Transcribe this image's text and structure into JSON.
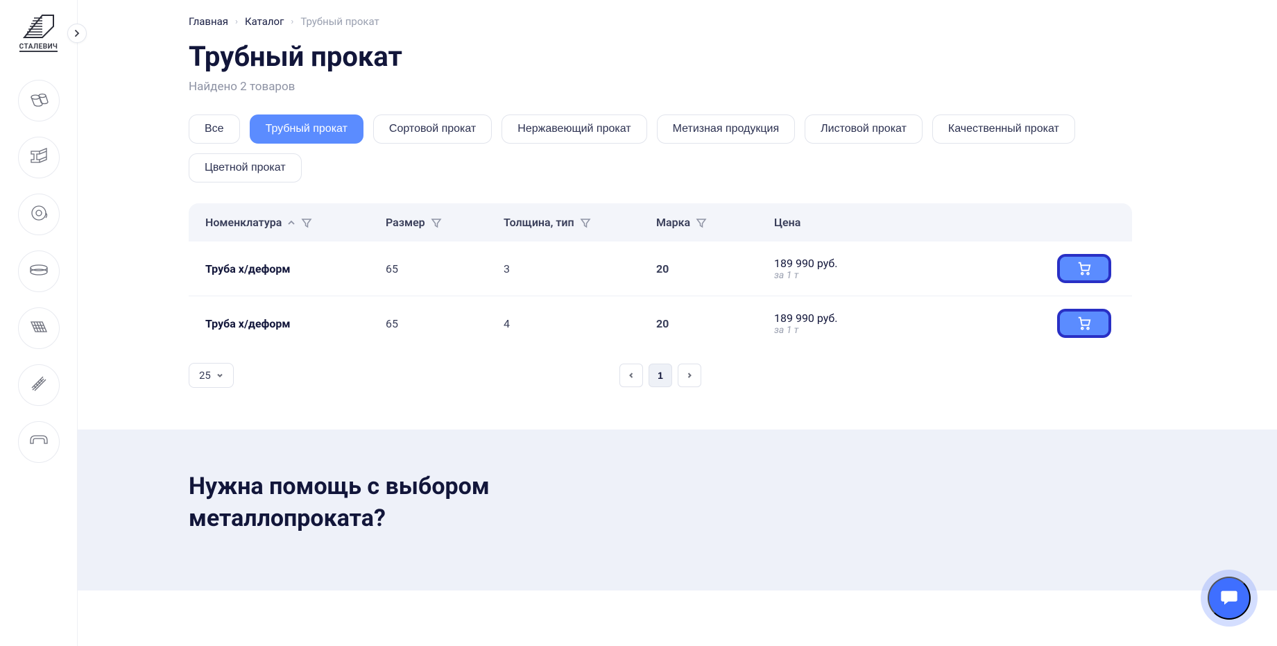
{
  "logo_text": "СТАЛЕВИЧ",
  "breadcrumb": {
    "home": "Главная",
    "catalog": "Каталог",
    "current": "Трубный прокат"
  },
  "page_title": "Трубный прокат",
  "found_text": "Найдено 2 товаров",
  "filters": {
    "items": [
      {
        "label": "Все",
        "active": false
      },
      {
        "label": "Трубный прокат",
        "active": true
      },
      {
        "label": "Сортовой прокат",
        "active": false
      },
      {
        "label": "Нержавеющий прокат",
        "active": false
      },
      {
        "label": "Метизная продукция",
        "active": false
      },
      {
        "label": "Листовой прокат",
        "active": false
      },
      {
        "label": "Качественный прокат",
        "active": false
      },
      {
        "label": "Цветной прокат",
        "active": false
      }
    ]
  },
  "table": {
    "headers": {
      "name": "Номенклатура",
      "size": "Размер",
      "thickness": "Толщина, тип",
      "mark": "Марка",
      "price": "Цена"
    },
    "rows": [
      {
        "name": "Труба х/деформ",
        "size": "65",
        "thickness": "3",
        "mark": "20",
        "price": "189 990 руб.",
        "price_sub": "за 1 т"
      },
      {
        "name": "Труба х/деформ",
        "size": "65",
        "thickness": "4",
        "mark": "20",
        "price": "189 990 руб.",
        "price_sub": "за 1 т"
      }
    ]
  },
  "pagination": {
    "page_size": "25",
    "current_page": "1"
  },
  "help": {
    "title": "Нужна помощь с выбором металлопроката?"
  },
  "sidebar_categories": [
    "pipes",
    "beams",
    "coils",
    "rings",
    "mesh",
    "rebar",
    "fittings"
  ]
}
